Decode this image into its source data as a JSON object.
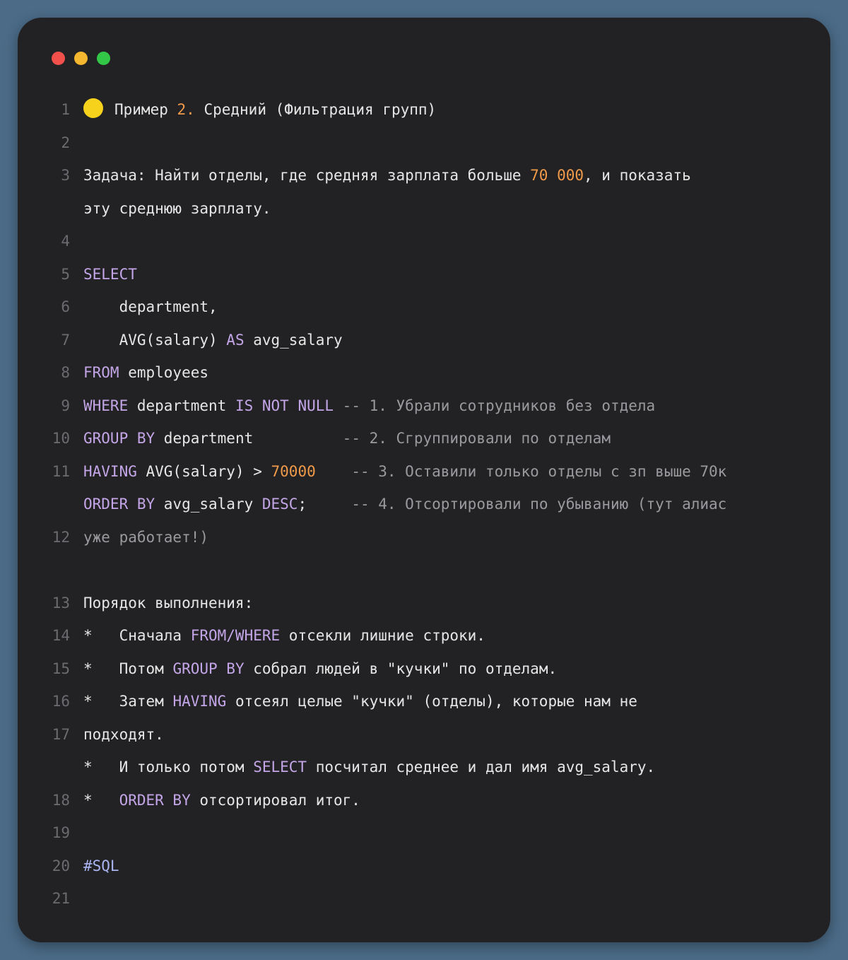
{
  "window": {
    "controls": {
      "close_color": "#f2504b",
      "minimize_color": "#f5b630",
      "zoom_color": "#33c748"
    }
  },
  "colors": {
    "keyword": "#c4a6e8",
    "number": "#f19a4a",
    "comment": "#9a9a9e",
    "hashtag": "#a9b4f0",
    "text": "#e6e6e6",
    "line_number": "#6c6c70",
    "emoji": "#f7d21c"
  },
  "icons": {
    "emoji": "yellow-circle-emoji"
  },
  "lines": [
    {
      "n": "1",
      "tokens": [
        {
          "t": "Пример ",
          "c": ""
        },
        {
          "t": "2.",
          "c": "num"
        },
        {
          "t": " Средний (Фильтрация групп)",
          "c": ""
        }
      ]
    },
    {
      "n": "2",
      "tokens": []
    },
    {
      "n": "3",
      "tokens": [
        {
          "t": "Задача: Найти отделы, где средняя зарплата больше ",
          "c": ""
        },
        {
          "t": "70 000",
          "c": "num"
        },
        {
          "t": ", и показать",
          "c": ""
        }
      ]
    },
    {
      "n": "",
      "tokens": [
        {
          "t": "эту среднюю зарплату.",
          "c": ""
        }
      ]
    },
    {
      "n": "4",
      "tokens": []
    },
    {
      "n": "5",
      "tokens": [
        {
          "t": "SELECT",
          "c": "kw"
        }
      ]
    },
    {
      "n": "6",
      "tokens": [
        {
          "t": "    department,",
          "c": ""
        }
      ]
    },
    {
      "n": "7",
      "tokens": [
        {
          "t": "    AVG(salary) ",
          "c": ""
        },
        {
          "t": "AS",
          "c": "kw"
        },
        {
          "t": " avg_salary",
          "c": ""
        }
      ]
    },
    {
      "n": "8",
      "tokens": [
        {
          "t": "FROM",
          "c": "kw"
        },
        {
          "t": " employees",
          "c": ""
        }
      ]
    },
    {
      "n": "9",
      "tokens": [
        {
          "t": "WHERE",
          "c": "kw"
        },
        {
          "t": " department ",
          "c": ""
        },
        {
          "t": "IS NOT NULL",
          "c": "kw"
        },
        {
          "t": " ",
          "c": ""
        },
        {
          "t": "-- 1. Убрали сотрудников без отдела",
          "c": "cm"
        }
      ]
    },
    {
      "n": "10",
      "tokens": [
        {
          "t": "GROUP BY",
          "c": "kw"
        },
        {
          "t": " department          ",
          "c": ""
        },
        {
          "t": "-- 2. Сгруппировали по отделам",
          "c": "cm"
        }
      ]
    },
    {
      "n": "11",
      "tokens": [
        {
          "t": "HAVING",
          "c": "kw"
        },
        {
          "t": " AVG(salary) > ",
          "c": ""
        },
        {
          "t": "70000",
          "c": "num"
        },
        {
          "t": "    ",
          "c": ""
        },
        {
          "t": "-- 3. Оставили только отделы с зп выше 70к",
          "c": "cm"
        }
      ]
    },
    {
      "n": "",
      "tokens": [
        {
          "t": "ORDER BY",
          "c": "kw"
        },
        {
          "t": " avg_salary ",
          "c": ""
        },
        {
          "t": "DESC",
          "c": "kw"
        },
        {
          "t": ";     ",
          "c": ""
        },
        {
          "t": "-- 4. Отсортировали по убыванию (тут алиас",
          "c": "cm"
        }
      ]
    },
    {
      "n": "12",
      "tokens": [
        {
          "t": "уже работает!)",
          "c": "cm"
        }
      ]
    },
    {
      "n": "",
      "tokens": []
    },
    {
      "n": "13",
      "tokens": [
        {
          "t": "Порядок выполнения:",
          "c": ""
        }
      ]
    },
    {
      "n": "14",
      "tokens": [
        {
          "t": "*   Сначала ",
          "c": ""
        },
        {
          "t": "FROM/WHERE",
          "c": "kw"
        },
        {
          "t": " отсекли лишние строки.",
          "c": ""
        }
      ]
    },
    {
      "n": "15",
      "tokens": [
        {
          "t": "*   Потом ",
          "c": ""
        },
        {
          "t": "GROUP BY",
          "c": "kw"
        },
        {
          "t": " собрал людей в \"кучки\" по отделам.",
          "c": ""
        }
      ]
    },
    {
      "n": "16",
      "tokens": [
        {
          "t": "*   Затем ",
          "c": ""
        },
        {
          "t": "HAVING",
          "c": "kw"
        },
        {
          "t": " отсеял целые \"кучки\" (отделы), которые нам не",
          "c": ""
        }
      ]
    },
    {
      "n": "17",
      "tokens": [
        {
          "t": "подходят.",
          "c": ""
        }
      ]
    },
    {
      "n": "",
      "tokens": [
        {
          "t": "*   И только потом ",
          "c": ""
        },
        {
          "t": "SELECT",
          "c": "kw"
        },
        {
          "t": " посчитал среднее и дал имя avg_salary.",
          "c": ""
        }
      ]
    },
    {
      "n": "18",
      "tokens": [
        {
          "t": "*   ",
          "c": ""
        },
        {
          "t": "ORDER BY",
          "c": "kw"
        },
        {
          "t": " отсортировал итог.",
          "c": ""
        }
      ]
    },
    {
      "n": "19",
      "tokens": []
    },
    {
      "n": "20",
      "tokens": [
        {
          "t": "#SQL",
          "c": "tag"
        }
      ]
    },
    {
      "n": "21",
      "tokens": []
    }
  ]
}
